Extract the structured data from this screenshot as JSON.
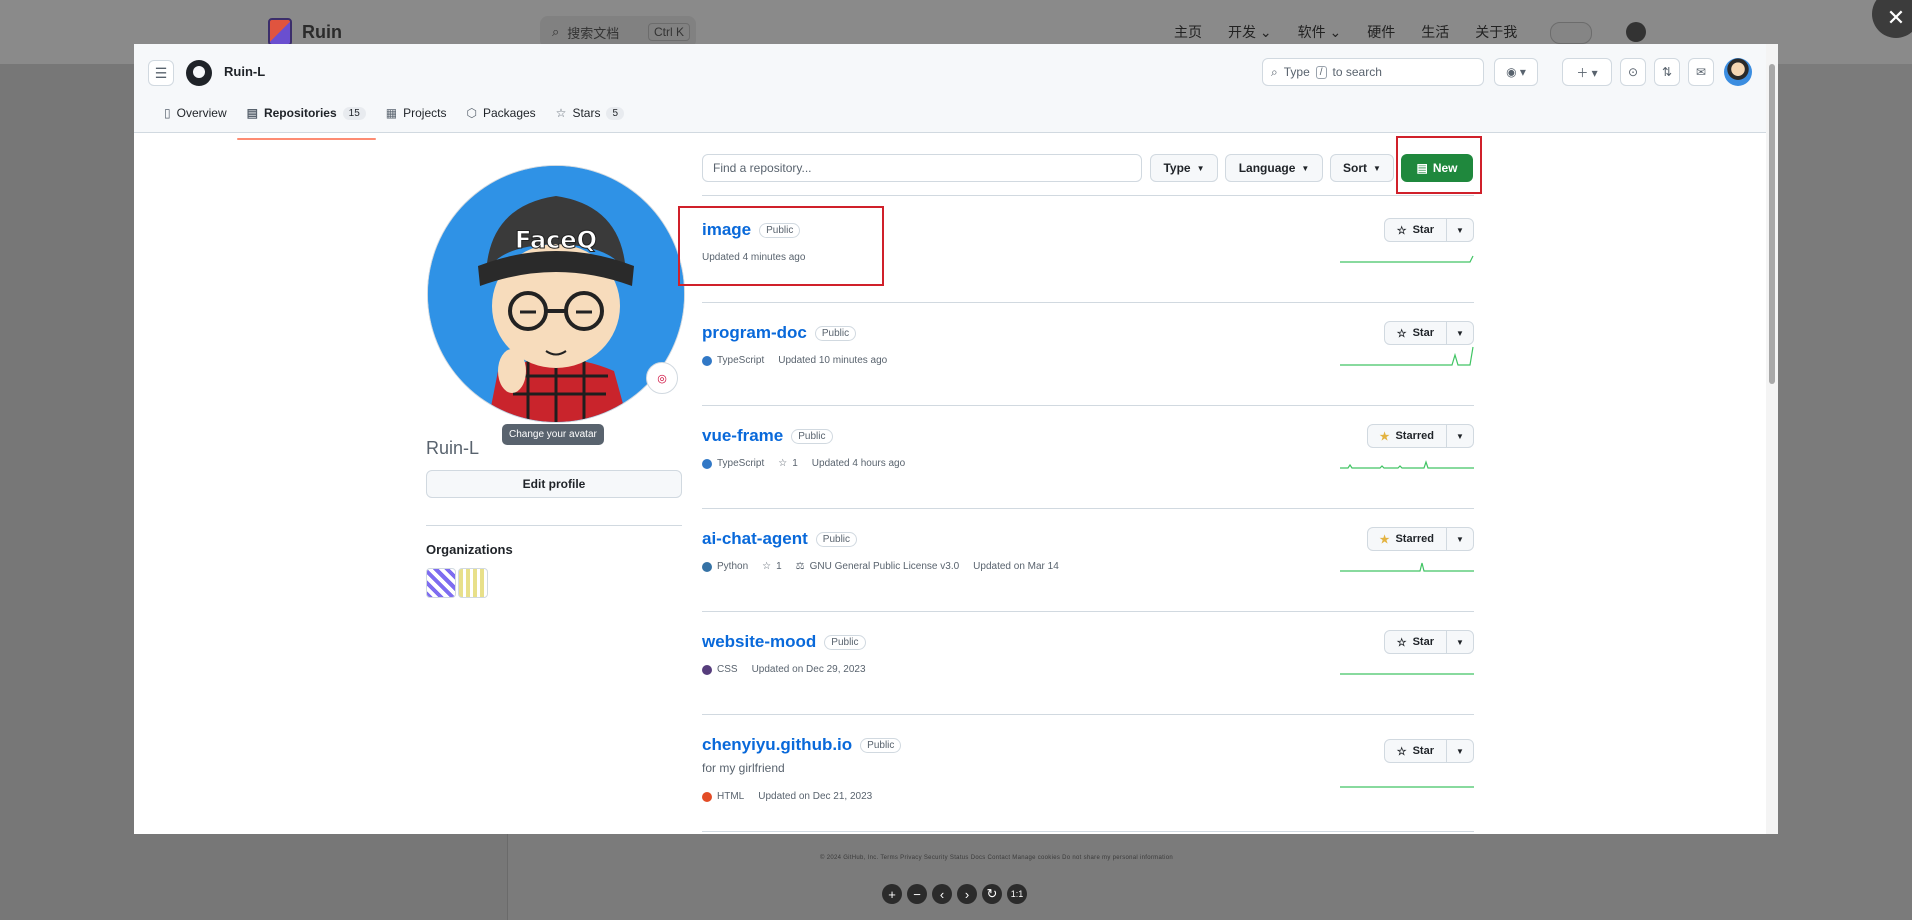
{
  "background": {
    "site_title": "Ruin",
    "search_placeholder": "搜索文档",
    "search_shortcut": "Ctrl K",
    "nav": [
      "主页",
      "开发 ⌄",
      "软件 ⌄",
      "硬件",
      "生活",
      "关于我"
    ],
    "close_glyph": "✕",
    "footer_text": "© 2024 GitHub, Inc.   Terms   Privacy   Security   Status   Docs   Contact   Manage cookies   Do not share my personal information",
    "zoom_controls": [
      "+",
      "−",
      "‹",
      "›",
      "↻",
      "1:1"
    ]
  },
  "header": {
    "username": "Ruin-L",
    "search_prefix": "Type",
    "search_key": "/",
    "search_suffix": "to search",
    "icons": [
      "menu-icon",
      "github-logo-icon",
      "copilot-icon",
      "plus-icon",
      "issues-icon",
      "pull-requests-icon",
      "inbox-icon"
    ]
  },
  "tabs": [
    {
      "label": "Overview",
      "icon": "book-icon"
    },
    {
      "label": "Repositories",
      "icon": "repo-icon",
      "count": "15",
      "active": true
    },
    {
      "label": "Projects",
      "icon": "table-icon"
    },
    {
      "label": "Packages",
      "icon": "package-icon"
    },
    {
      "label": "Stars",
      "icon": "star-icon",
      "count": "5"
    }
  ],
  "profile": {
    "display_name": "Ruin-L",
    "tooltip": "Change your avatar",
    "edit_button": "Edit profile",
    "orgs_heading": "Organizations",
    "avatar_hat_text": "FaceQ"
  },
  "filters": {
    "find_placeholder": "Find a repository...",
    "type_label": "Type",
    "language_label": "Language",
    "sort_label": "Sort",
    "new_label": "New"
  },
  "repos": [
    {
      "name": "image",
      "visibility": "Public",
      "language": "",
      "lang_color": "",
      "stars": "",
      "license": "",
      "updated": "Updated 4 minutes ago",
      "starred": false,
      "star_label": "Star",
      "description": ""
    },
    {
      "name": "program-doc",
      "visibility": "Public",
      "language": "TypeScript",
      "lang_color": "#3178c6",
      "stars": "",
      "license": "",
      "updated": "Updated 10 minutes ago",
      "starred": false,
      "star_label": "Star",
      "description": ""
    },
    {
      "name": "vue-frame",
      "visibility": "Public",
      "language": "TypeScript",
      "lang_color": "#3178c6",
      "stars": "1",
      "license": "",
      "updated": "Updated 4 hours ago",
      "starred": true,
      "star_label": "Starred",
      "description": ""
    },
    {
      "name": "ai-chat-agent",
      "visibility": "Public",
      "language": "Python",
      "lang_color": "#3572A5",
      "stars": "1",
      "license": "GNU General Public License v3.0",
      "updated": "Updated on Mar 14",
      "starred": true,
      "star_label": "Starred",
      "description": ""
    },
    {
      "name": "website-mood",
      "visibility": "Public",
      "language": "CSS",
      "lang_color": "#563d7c",
      "stars": "",
      "license": "",
      "updated": "Updated on Dec 29, 2023",
      "starred": false,
      "star_label": "Star",
      "description": ""
    },
    {
      "name": "chenyiyu.github.io",
      "visibility": "Public",
      "language": "HTML",
      "lang_color": "#e34c26",
      "stars": "",
      "license": "",
      "updated": "Updated on Dec 21, 2023",
      "starred": false,
      "star_label": "Star",
      "description": "for my girlfriend"
    }
  ],
  "colors": {
    "accent_green": "#1f883d",
    "link_blue": "#0969da",
    "highlight_red": "#d0202a",
    "tab_underline": "#fd8c73"
  }
}
